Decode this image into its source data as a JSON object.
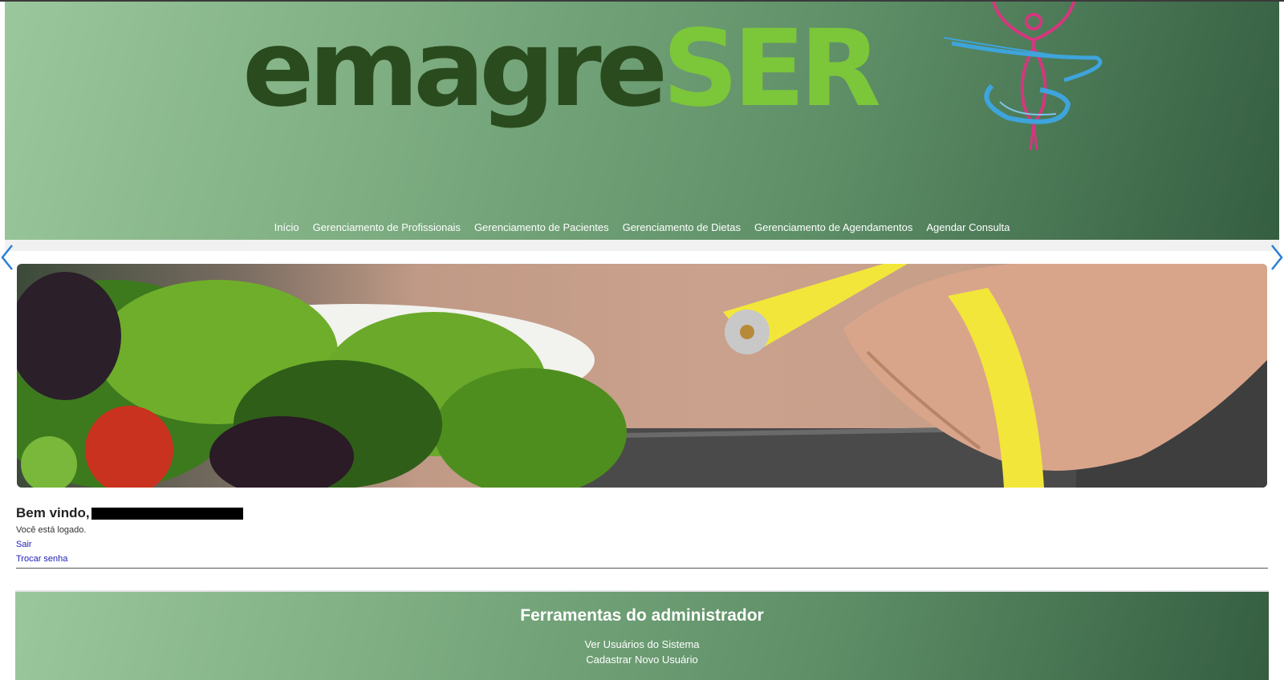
{
  "logo": {
    "part1": "emagre",
    "part2": "SER"
  },
  "nav": [
    "Início",
    "Gerenciamento de Profissionais",
    "Gerenciamento de Pacientes",
    "Gerenciamento de Dietas",
    "Gerenciamento de Agendamentos",
    "Agendar Consulta"
  ],
  "welcome": {
    "greeting": "Bem vindo,",
    "status": "Você está logado.",
    "logout": "Sair",
    "change_password": "Trocar senha"
  },
  "admin": {
    "title": "Ferramentas do administrador",
    "links": [
      "Ver Usuários do Sistema",
      "Cadastrar Novo Usuário"
    ]
  },
  "colors": {
    "logo_dark": "#2a4b1e",
    "logo_light": "#7cc63a",
    "header_start": "#9bc79c",
    "header_end": "#355e41",
    "link": "#1c1cb8",
    "arrow": "#2a7fd4"
  },
  "icons": {
    "carousel_prev": "chevron-left-icon",
    "carousel_next": "chevron-right-icon"
  }
}
